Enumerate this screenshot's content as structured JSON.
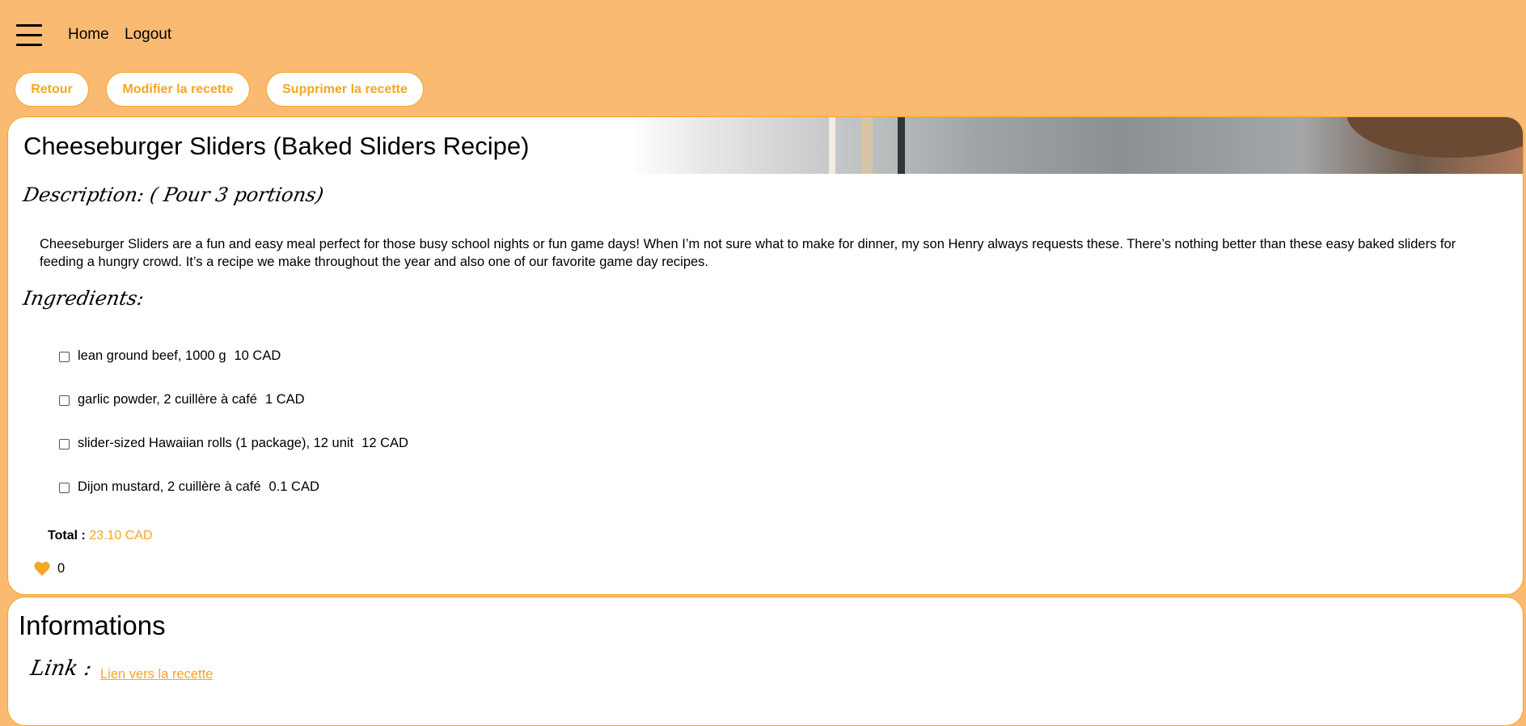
{
  "nav": {
    "menu_icon": "hamburger-menu-icon",
    "links": [
      {
        "label": "Home"
      },
      {
        "label": "Logout"
      }
    ]
  },
  "actions": {
    "back": "Retour",
    "edit": "Modifier la recette",
    "delete": "Supprimer la recette"
  },
  "recipe": {
    "title": "Cheeseburger Sliders (Baked Sliders Recipe)",
    "description_heading": "Description: ( Pour 3 portions)",
    "description": "Cheeseburger Sliders are a fun and easy meal perfect for those busy school nights or fun game days! When I’m not sure what to make for dinner, my son Henry always requests these. There’s nothing better than these easy baked sliders for feeding a hungry crowd. It’s a recipe we make throughout the year and also one of our favorite game day recipes.",
    "ingredients_heading": "Ingredients:",
    "ingredients": [
      {
        "name": "lean ground beef, 1000 g",
        "price": "10 CAD"
      },
      {
        "name": "garlic powder, 2 cuillère à café",
        "price": "1 CAD"
      },
      {
        "name": "slider-sized Hawaiian rolls (1 package), 12 unit",
        "price": "12 CAD"
      },
      {
        "name": "Dijon mustard, 2 cuillère à café",
        "price": "0.1 CAD"
      }
    ],
    "total_label": "Total :",
    "total_value": "23.10 CAD",
    "likes": "0"
  },
  "info": {
    "title": "Informations",
    "link_label": "Link :",
    "link_text": "Lien vers la recette"
  },
  "colors": {
    "background": "#FBBA72",
    "accent": "#F5A623"
  }
}
